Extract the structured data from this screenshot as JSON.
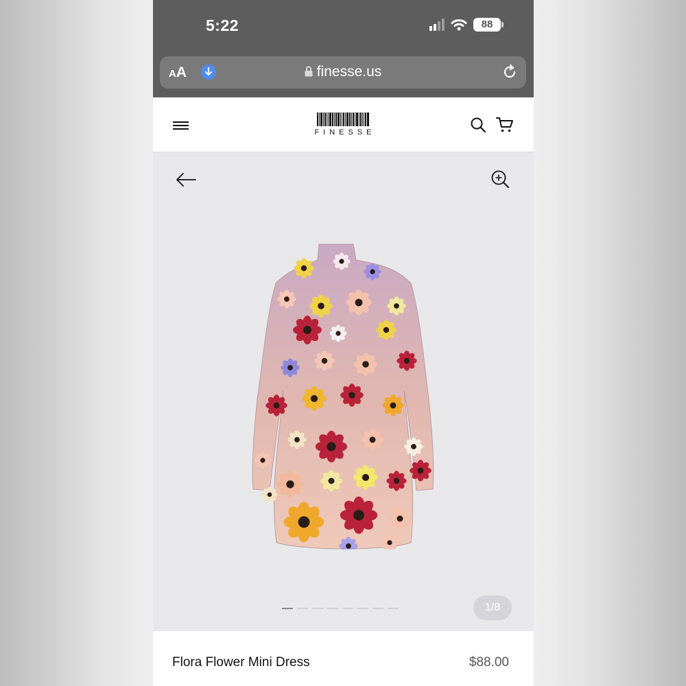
{
  "status_bar": {
    "time": "5:22",
    "battery": "88"
  },
  "browser": {
    "text_size_small": "A",
    "text_size_large": "A",
    "url": "finesse.us"
  },
  "site": {
    "logo_text": "FINESSE"
  },
  "gallery": {
    "counter": "1/8",
    "image_count": 8,
    "active_index": 0
  },
  "product": {
    "name": "Flora Flower Mini Dress",
    "price": "$88.00"
  },
  "icons": [
    "signal-icon",
    "wifi-icon",
    "battery-icon",
    "download-icon",
    "lock-icon",
    "reload-icon",
    "menu-icon",
    "search-icon",
    "cart-icon",
    "back-arrow-icon",
    "zoom-in-icon"
  ]
}
